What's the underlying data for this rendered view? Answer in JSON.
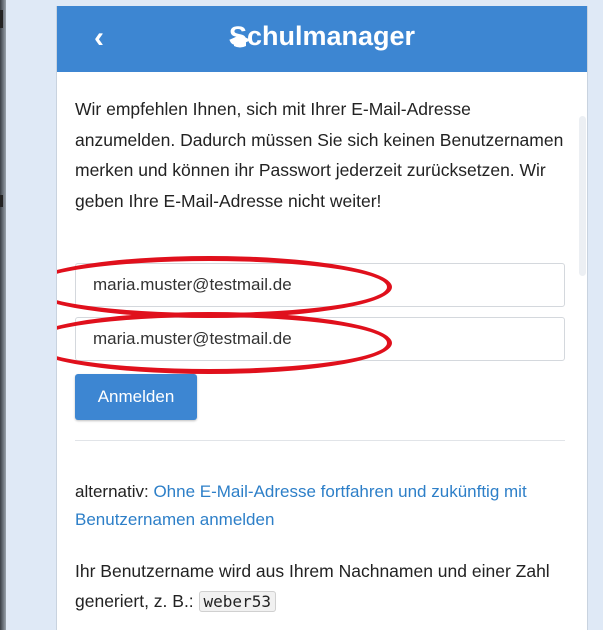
{
  "app": {
    "title": "Schulmanager",
    "back_glyph": "‹"
  },
  "intro_text": "Wir empfehlen Ihnen, sich mit Ihrer E-Mail-Adresse anzumelden. Dadurch müssen Sie sich keinen Benutzernamen merken und können ihr Passwort jederzeit zurücksetzen. Wir geben Ihre E-Mail-Adresse nicht weiter!",
  "form": {
    "email_value": "maria.muster@testmail.de",
    "email_confirm_value": "maria.muster@testmail.de",
    "login_label": "Anmelden"
  },
  "alternative": {
    "prefix": "alternativ: ",
    "link_text": "Ohne E-Mail-Adresse fortfahren und zukünftig mit Benutzernamen anmelden"
  },
  "info": {
    "text": "Ihr Benutzername wird aus Ihrem Nachnamen und einer Zahl generiert, z. B.: ",
    "example_username": "weber53"
  },
  "colors": {
    "brand": "#3d86d2",
    "link": "#2d7fc8",
    "highlight_ring": "#e0101c"
  },
  "icons": {
    "back": "chevron-left-icon",
    "logo": "graduation-cap-icon"
  }
}
